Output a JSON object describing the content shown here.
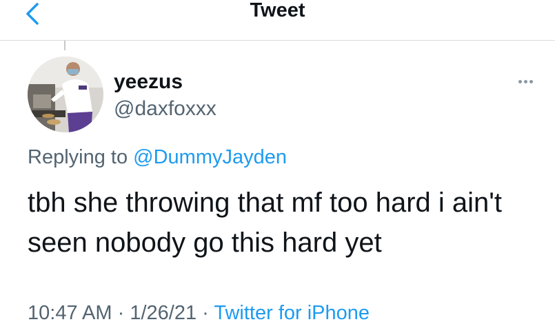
{
  "header": {
    "title": "Tweet",
    "back_icon": "chevron-left-icon"
  },
  "tweet": {
    "author": {
      "name": "yeezus",
      "handle": "@daxfoxxx"
    },
    "replying_prefix": "Replying to",
    "replying_to": "@DummyJayden",
    "text": "tbh she throwing that mf too hard i ain't seen nobody go this hard yet",
    "time": "10:47 AM",
    "date": "1/26/21",
    "separator": "·",
    "source": "Twitter for iPhone"
  },
  "colors": {
    "accent": "#1d9bf0",
    "secondary_text": "#536471",
    "primary_text": "#0f1419"
  }
}
